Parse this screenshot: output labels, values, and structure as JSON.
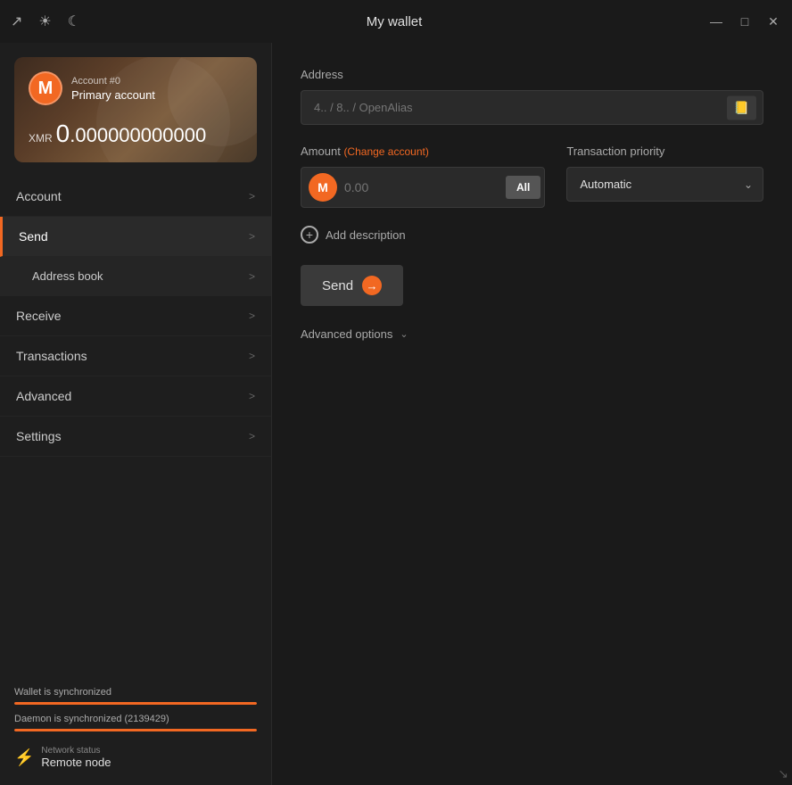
{
  "titleBar": {
    "title": "My wallet",
    "icons": [
      "arrow-icon",
      "globe-icon",
      "moon-icon"
    ],
    "controls": [
      "minimize",
      "maximize",
      "close"
    ]
  },
  "sidebar": {
    "account": {
      "number": "Account #0",
      "name": "Primary account",
      "currency": "XMR",
      "balance_integer": "0",
      "balance_decimal": ".000000000000"
    },
    "navItems": [
      {
        "label": "Account",
        "active": false,
        "sub": false
      },
      {
        "label": "Send",
        "active": true,
        "sub": false
      },
      {
        "label": "Address book",
        "active": false,
        "sub": true
      },
      {
        "label": "Receive",
        "active": false,
        "sub": false
      },
      {
        "label": "Transactions",
        "active": false,
        "sub": false
      },
      {
        "label": "Advanced",
        "active": false,
        "sub": false
      },
      {
        "label": "Settings",
        "active": false,
        "sub": false
      }
    ],
    "sync": {
      "wallet_label": "Wallet is synchronized",
      "daemon_label": "Daemon is synchronized (2139429)",
      "network_label": "Network status",
      "network_value": "Remote node"
    }
  },
  "main": {
    "address": {
      "label": "Address",
      "placeholder": "4.. / 8.. / OpenAlias"
    },
    "amount": {
      "label": "Amount",
      "change_account": "(Change account)",
      "placeholder": "0.00",
      "all_button": "All"
    },
    "priority": {
      "label": "Transaction priority",
      "value": "Automatic"
    },
    "add_description": "Add description",
    "send_button": "Send",
    "advanced_options": "Advanced options"
  }
}
